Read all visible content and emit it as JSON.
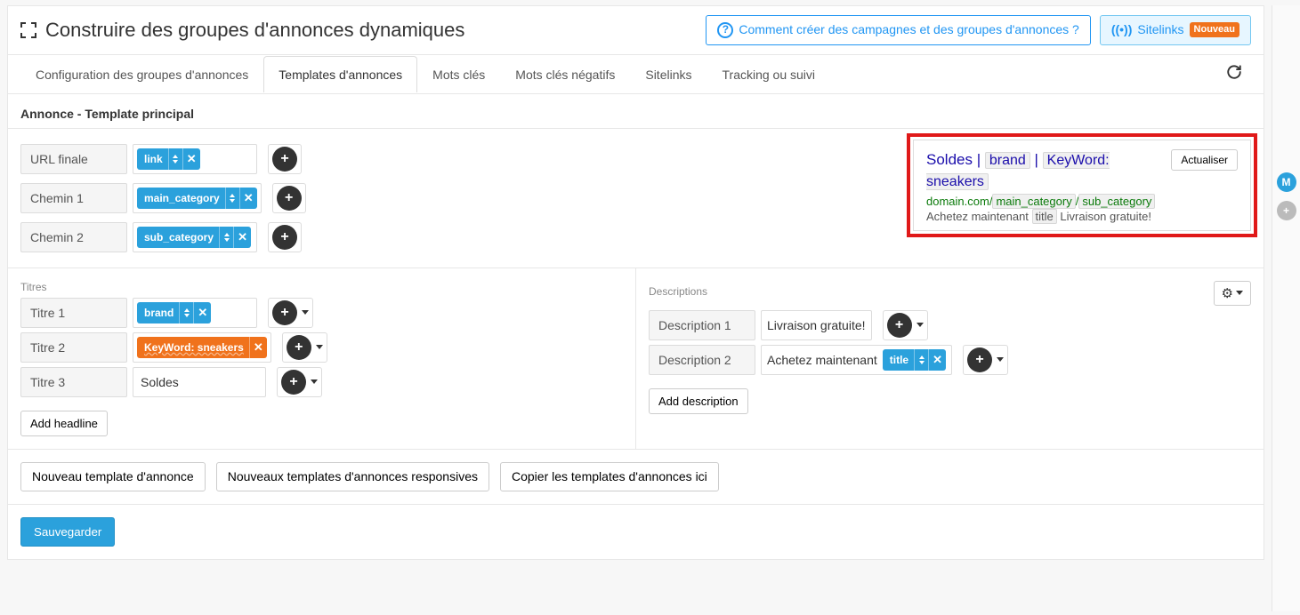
{
  "header": {
    "page_title": "Construire des groupes d'annonces dynamiques",
    "help_link": "Comment créer des campagnes et des groupes d'annonces ?",
    "sitelinks_button": "Sitelinks",
    "sitelinks_badge": "Nouveau"
  },
  "tabs": {
    "items": [
      "Configuration des groupes d'annonces",
      "Templates d'annonces",
      "Mots clés",
      "Mots clés négatifs",
      "Sitelinks",
      "Tracking ou suivi"
    ],
    "active_index": 1
  },
  "subheader": "Annonce - Template principal",
  "url_block": {
    "rows": [
      {
        "label": "URL finale",
        "token": "link"
      },
      {
        "label": "Chemin 1",
        "token": "main_category"
      },
      {
        "label": "Chemin 2",
        "token": "sub_category"
      }
    ]
  },
  "preview": {
    "t3": "Soldes",
    "t1_tok": "brand",
    "t2_tok": "KeyWord: sneakers",
    "domain": "domain.com",
    "p1_tok": "main_category",
    "p2_tok": "sub_category",
    "d2_text": "Achetez maintenant",
    "d2_tok": "title",
    "d1": "Livraison gratuite!",
    "update_btn": "Actualiser"
  },
  "titles": {
    "section_label": "Titres",
    "rows": [
      {
        "label": "Titre 1",
        "token": "brand",
        "color": "blue"
      },
      {
        "label": "Titre 2",
        "token": "KeyWord: sneakers",
        "color": "orange"
      },
      {
        "label": "Titre 3",
        "text": "Soldes"
      }
    ],
    "add_label": "Add headline"
  },
  "descriptions": {
    "section_label": "Descriptions",
    "rows": [
      {
        "label": "Description 1",
        "text": "Livraison gratuite!"
      },
      {
        "label": "Description 2",
        "text": "Achetez maintenant",
        "token": "title"
      }
    ],
    "add_label": "Add description"
  },
  "actions": {
    "new_template": "Nouveau template d'annonce",
    "new_responsive": "Nouveaux templates d'annonces responsives",
    "copy_here": "Copier les templates d'annonces ici"
  },
  "footer": {
    "save": "Sauvegarder"
  },
  "rail": {
    "m": "M",
    "plus": "+"
  }
}
